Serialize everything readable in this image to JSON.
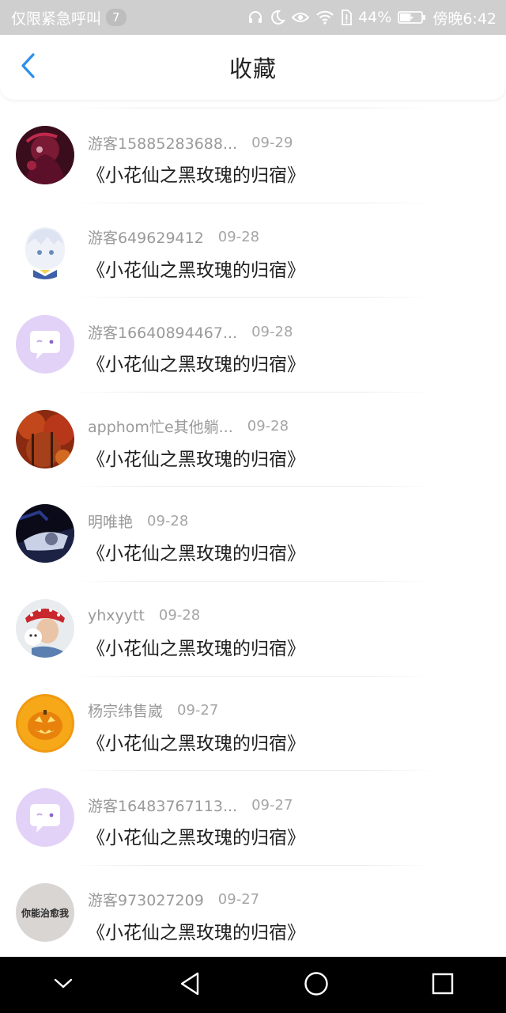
{
  "status_bar": {
    "left_text": "仅限紧急呼叫",
    "notification_count": "7",
    "battery": "44%",
    "time": "傍晚6:42",
    "icons": [
      "headset-icon",
      "moon-icon",
      "eye-icon",
      "wifi-icon",
      "sim-alert-icon",
      "battery-icon"
    ]
  },
  "header": {
    "title": "收藏",
    "back_icon": "chevron-left-icon",
    "accent_color": "#2b8ef0"
  },
  "list": [
    {
      "user": "游客15885283688...",
      "date": "09-29",
      "title": "《小花仙之黑玫瑰的归宿》",
      "avatar": "anime-girl-dark"
    },
    {
      "user": "游客649629412",
      "date": "09-28",
      "title": "《小花仙之黑玫瑰的归宿》",
      "avatar": "anime-girl-white"
    },
    {
      "user": "游客16640894467...",
      "date": "09-28",
      "title": "《小花仙之黑玫瑰的归宿》",
      "avatar": "default-chat-bubble"
    },
    {
      "user": "apphom忙e其他躺...",
      "date": "09-28",
      "title": "《小花仙之黑玫瑰的归宿》",
      "avatar": "red-forest"
    },
    {
      "user": "明唯艳",
      "date": "09-28",
      "title": "《小花仙之黑玫瑰的归宿》",
      "avatar": "dark-photo"
    },
    {
      "user": "yhxyytt",
      "date": "09-28",
      "title": "《小花仙之黑玫瑰的归宿》",
      "avatar": "person-photo"
    },
    {
      "user": "杨宗纬售崴",
      "date": "09-27",
      "title": "《小花仙之黑玫瑰的归宿》",
      "avatar": "pumpkin"
    },
    {
      "user": "游客16483767113...",
      "date": "09-27",
      "title": "《小花仙之黑玫瑰的归宿》",
      "avatar": "default-chat-bubble"
    },
    {
      "user": "游客973027209",
      "date": "09-27",
      "title": "《小花仙之黑玫瑰的归宿》",
      "avatar": "text-avatar",
      "avatar_text": "你能治愈我"
    }
  ],
  "nav_bar": {
    "buttons": [
      "chevron-down-icon",
      "back-triangle-icon",
      "home-circle-icon",
      "recents-square-icon"
    ]
  }
}
